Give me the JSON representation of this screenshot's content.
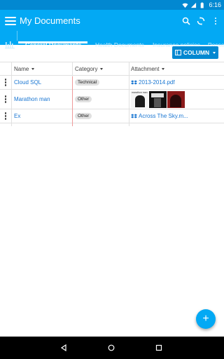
{
  "status_bar": {
    "time": "6:16",
    "icons": [
      "wifi-icon",
      "signal-icon",
      "battery-icon"
    ]
  },
  "app_bar": {
    "title": "My Documents",
    "actions": [
      "search-icon",
      "sync-icon",
      "more-vert-icon"
    ]
  },
  "tabs": [
    {
      "label": "General Documents",
      "active": true
    },
    {
      "label": "Health Documents",
      "active": false
    },
    {
      "label": "Insurance policies",
      "active": false
    },
    {
      "label": "Posse",
      "active": false
    }
  ],
  "toolbar": {
    "column_label": "COLUMN"
  },
  "table": {
    "headers": [
      "Name",
      "Category",
      "Attachment"
    ],
    "rows": [
      {
        "name": "Cloud SQL",
        "category": "Technical",
        "attachment": "2013-2014.pdf",
        "type": "file"
      },
      {
        "name": "Marathon man",
        "category": "Other",
        "attachment": "",
        "type": "images",
        "thumb_caption": "marathon man"
      },
      {
        "name": "Ex",
        "category": "Other",
        "attachment": "Across The Sky.m...",
        "type": "file"
      }
    ]
  },
  "fab": {
    "label": "+"
  },
  "colors": {
    "primary": "#03a9f4",
    "primary_dark": "#0288d1",
    "link": "#1976d2",
    "chip": "#e0e0e0"
  }
}
